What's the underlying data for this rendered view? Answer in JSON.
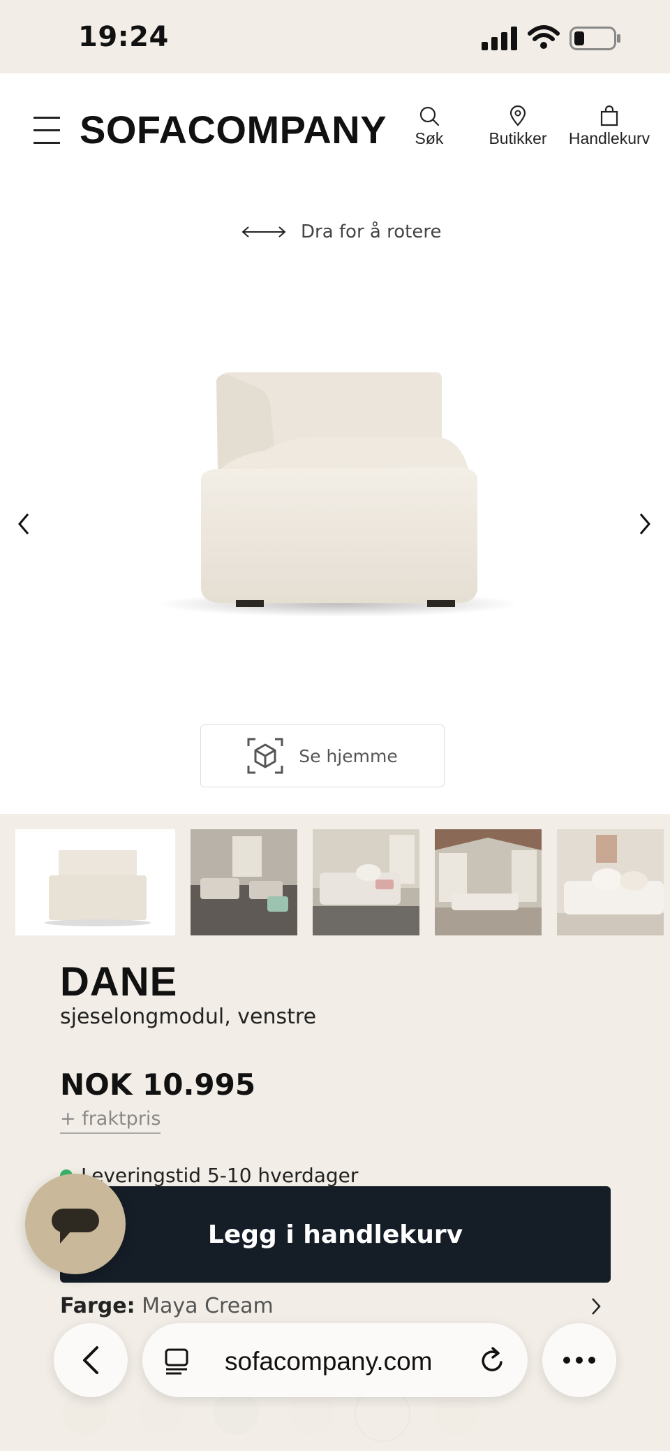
{
  "status": {
    "time": "19:24"
  },
  "header": {
    "logo": "SOFACOMPANY",
    "nav": {
      "search": "Søk",
      "stores": "Butikker",
      "cart": "Handlekurv"
    }
  },
  "viewer": {
    "rotate_hint": "Dra for å rotere",
    "ar_button": "Se hjemme"
  },
  "product": {
    "name": "DANE",
    "subtitle": "sjeselongmodul, venstre",
    "price": "NOK 10.995",
    "shipping_link": "+ fraktpris",
    "delivery": "Leveringstid 5-10 hverdager",
    "add_to_cart": "Legg i handlekurv",
    "color_label": "Farge:",
    "color_value": "Maya Cream"
  },
  "browser": {
    "url": "sofacompany.com"
  },
  "colors": {
    "background": "#f2eee7",
    "cta": "#151d27",
    "chat": "#c9b99a",
    "delivery_dot": "#3bb36a"
  }
}
